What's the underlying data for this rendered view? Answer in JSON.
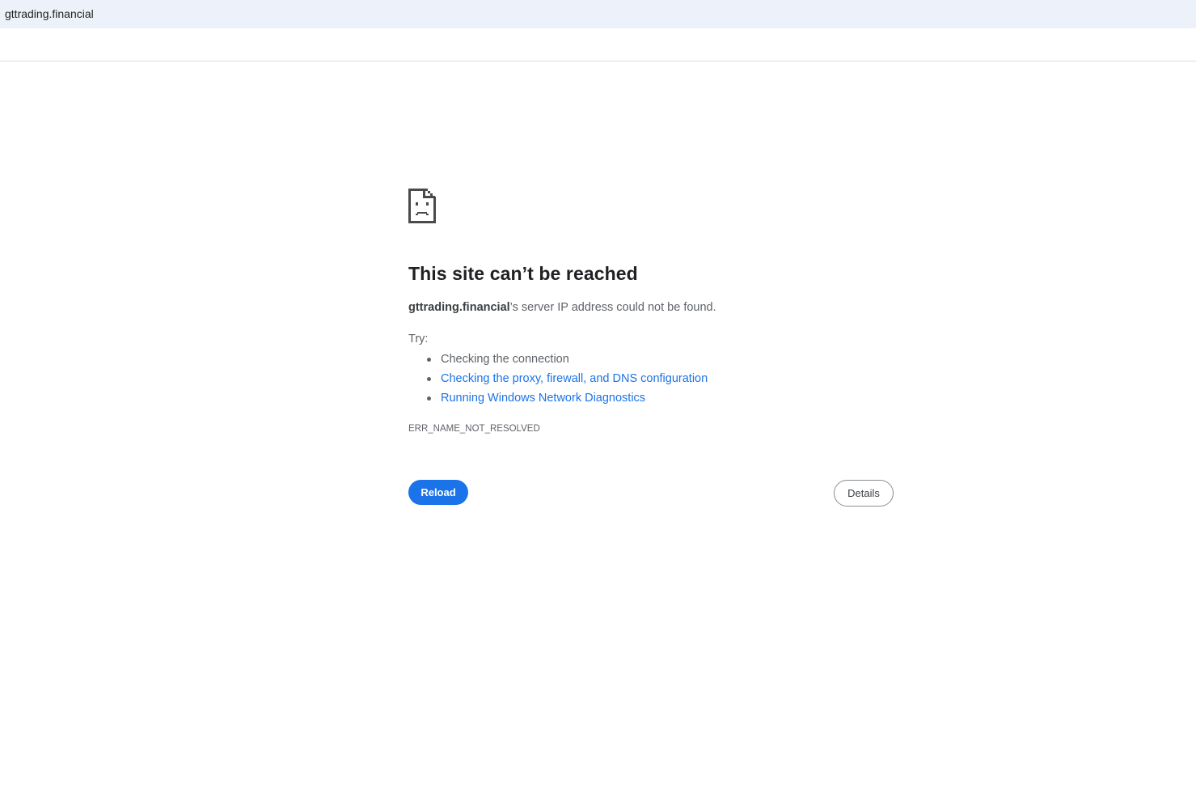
{
  "address_bar": {
    "url": "gttrading.financial"
  },
  "error_page": {
    "icon": "sad-document-icon",
    "heading": "This site can’t be reached",
    "host": "gttrading.financial",
    "summary_suffix": "’s server IP address could not be found.",
    "try_label": "Try:",
    "suggestions": [
      {
        "label": "Checking the connection",
        "is_link": false
      },
      {
        "label": "Checking the proxy, firewall, and DNS configuration",
        "is_link": true
      },
      {
        "label": "Running Windows Network Diagnostics",
        "is_link": true
      }
    ],
    "error_code": "ERR_NAME_NOT_RESOLVED",
    "reload_label": "Reload",
    "details_label": "Details"
  },
  "colors": {
    "accent": "#1a73e8",
    "address_bar_bg": "#edf2fa",
    "secondary_text": "#5f6368"
  }
}
